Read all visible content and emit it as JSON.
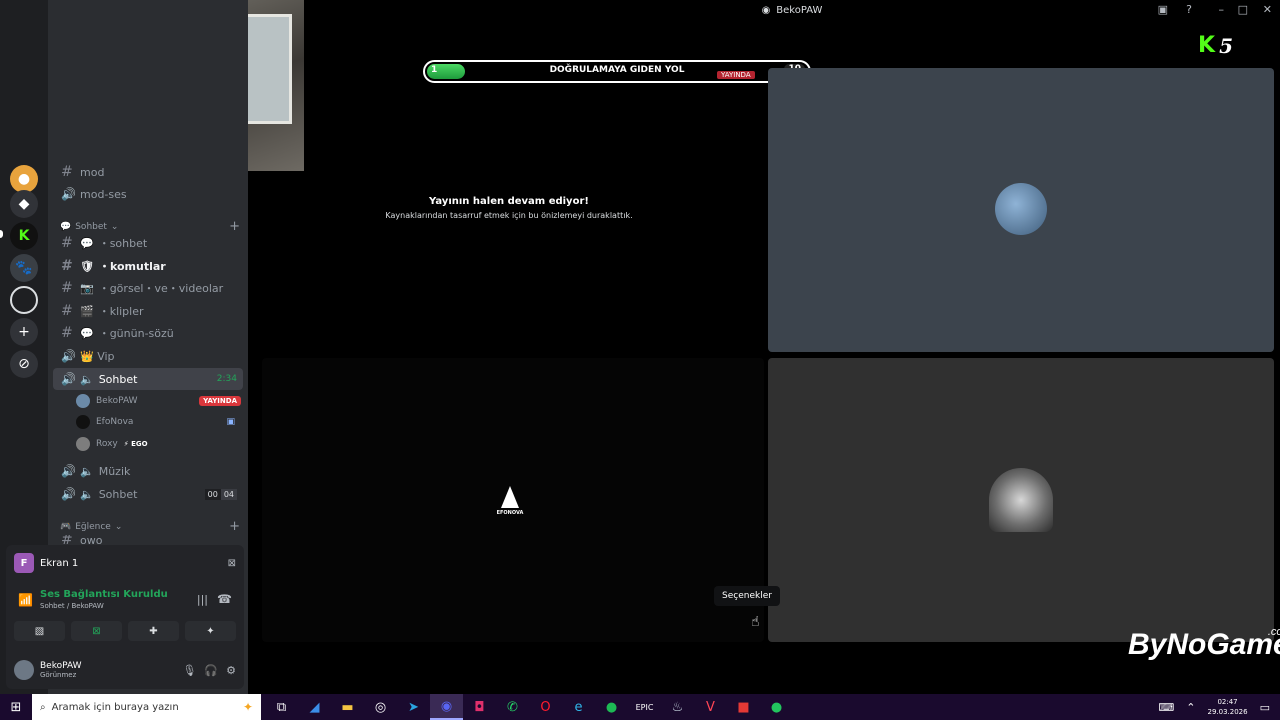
{
  "window": {
    "title": "BekoPAW"
  },
  "rail": {
    "icons": [
      "server-colorful-icon",
      "discover-icon",
      "kick-server-icon",
      "animal-server-icon",
      "loading-icon",
      "add-server-icon",
      "explore-icon"
    ]
  },
  "channels": {
    "top": [
      {
        "type": "text",
        "label": "mod"
      },
      {
        "type": "voice",
        "label": "mod-ses"
      }
    ],
    "category_chat": "Sohbet",
    "list": [
      {
        "type": "text",
        "emoji": "💬",
        "label": "・sohbet",
        "bold": false
      },
      {
        "type": "text",
        "emoji": "🛡",
        "label": "・komutlar",
        "bold": true
      },
      {
        "type": "text",
        "emoji": "📷",
        "label": "・görsel・ve・videolar",
        "bold": false
      },
      {
        "type": "text",
        "emoji": "🎬",
        "label": "・klipler",
        "bold": false
      },
      {
        "type": "text",
        "emoji": "💬",
        "label": "・günün-sözü",
        "bold": false
      }
    ],
    "vip": "👑 Vip",
    "active_voice": {
      "label": "Sohbet",
      "time": "2:34"
    },
    "voice_users": [
      {
        "name": "BekoPAW",
        "badge": "YAYINDA"
      },
      {
        "name": "EfoNova",
        "badge": ""
      },
      {
        "name": "Roxy",
        "badge": "⚡ EGO"
      }
    ],
    "music": "Müzik",
    "voice_chat2": {
      "label": "Sohbet",
      "count_a": "00",
      "count_b": "04"
    },
    "category_fun": "Eğlence",
    "cut_off": "owo"
  },
  "panel": {
    "screen_label": "Ekran 1",
    "screen_initial": "F",
    "voice_status": "Ses Bağlantısı Kuruldu",
    "voice_location": "Sohbet / BekoPAW",
    "user_name": "BekoPAW",
    "user_status": "Görünmez"
  },
  "stream": {
    "banner_left": "1",
    "banner_title": "DOĞRULAMAYA GIDEN YOL",
    "banner_live": "YAYINDA",
    "banner_right": "10",
    "banner_progress": 0.1,
    "notice_title": "Yayının halen devam ediyor!",
    "notice_sub": "Kaynaklarından tasarruf etmek için bu önizlemeyi duraklattık.",
    "efonova_label": "EFONOVA",
    "tooltip": "Seçenekler",
    "kick_number": "5",
    "watermark": "ByNoGame",
    "watermark_tld": ".com"
  },
  "taskbar": {
    "search_placeholder": "Aramak için buraya yazın",
    "apps": [
      "task-view-icon",
      "app-blue-icon",
      "file-explorer-icon",
      "obs-icon",
      "telegram-icon",
      "discord-icon",
      "instagram-icon",
      "whatsapp-icon",
      "opera-icon",
      "edge-icon",
      "spotify-icon",
      "epic-games-icon",
      "steam-icon",
      "valorant-icon",
      "red-app-icon",
      "green-app-icon"
    ],
    "time": "02:47",
    "date": "29.03.2026"
  }
}
